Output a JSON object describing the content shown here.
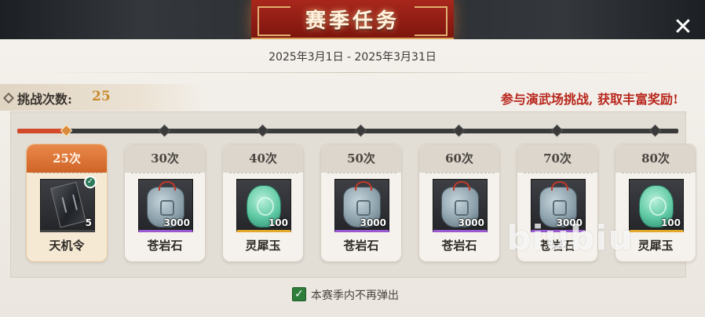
{
  "window": {
    "title": "赛季任务",
    "close_glyph": "✕"
  },
  "season": {
    "date_range": "2025年3月1日 - 2025年3月31日"
  },
  "challenge": {
    "label": "挑战次数:",
    "value": "25",
    "promo": "参与演武场挑战, 获取丰富奖励!"
  },
  "progress": {
    "current": 25,
    "fill_fraction": 0.07,
    "fill_color": "#d24a2a"
  },
  "rewards": [
    {
      "threshold": "25次",
      "item": "天机令",
      "qty": "5",
      "icon": "token-icon",
      "rarity": "dark",
      "claimed": true
    },
    {
      "threshold": "30次",
      "item": "苍岩石",
      "qty": "3000",
      "icon": "stone-icon",
      "rarity": "purple",
      "claimed": false
    },
    {
      "threshold": "40次",
      "item": "灵犀玉",
      "qty": "100",
      "icon": "jade-icon",
      "rarity": "gold",
      "claimed": false
    },
    {
      "threshold": "50次",
      "item": "苍岩石",
      "qty": "3000",
      "icon": "stone-icon",
      "rarity": "purple",
      "claimed": false
    },
    {
      "threshold": "60次",
      "item": "苍岩石",
      "qty": "3000",
      "icon": "stone-icon",
      "rarity": "purple",
      "claimed": false
    },
    {
      "threshold": "70次",
      "item": "苍岩石",
      "qty": "3000",
      "icon": "stone-icon",
      "rarity": "purple",
      "claimed": false
    },
    {
      "threshold": "80次",
      "item": "灵犀玉",
      "qty": "100",
      "icon": "jade-icon",
      "rarity": "gold",
      "claimed": false
    }
  ],
  "claimed_glyph": "✓",
  "footer": {
    "checkbox_glyph": "✓",
    "checkbox_label": "本赛季内不再弹出",
    "checked": true
  },
  "watermark": "biubiu",
  "colors": {
    "title_red": "#a8271c",
    "promo_red": "#b8261c",
    "count_gold": "#c98a2d",
    "active_orange": "#d06328"
  }
}
